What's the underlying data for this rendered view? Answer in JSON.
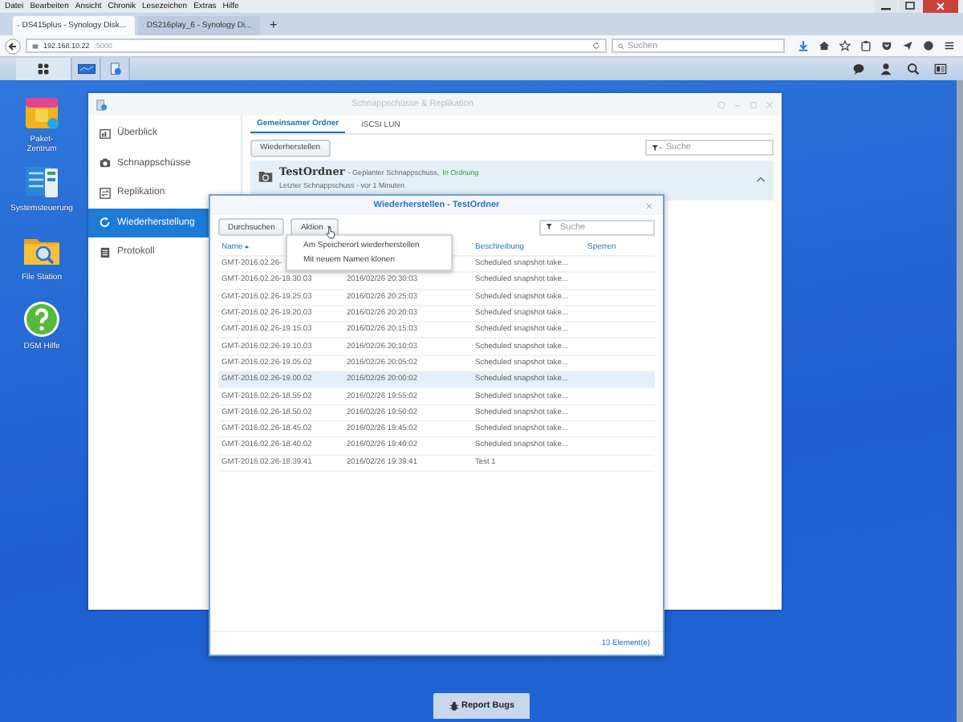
{
  "browser": {
    "menu": [
      "Datei",
      "Bearbeiten",
      "Ansicht",
      "Chronik",
      "Lesezeichen",
      "Extras",
      "Hilfe"
    ],
    "tabs": [
      {
        "label": "DS415plus - Synology Disk...",
        "selected": true
      },
      {
        "label": "DS216play_6 - Synology Di...",
        "selected": false
      }
    ],
    "new_tab": "+",
    "address": {
      "host": "192.168.10.22",
      "port": ":5000"
    },
    "search": {
      "placeholder": "Suchen"
    }
  },
  "desktop_icons": [
    {
      "label": "Paket-Zentrum",
      "kind": "package"
    },
    {
      "label": "Systemsteuerung",
      "kind": "settings"
    },
    {
      "label": "File Station",
      "kind": "folder"
    },
    {
      "label": "DSM Hilfe",
      "kind": "help"
    }
  ],
  "window": {
    "title": "Schnappschüsse & Replikation",
    "sidebar": [
      {
        "label": "Überblick",
        "kind": "overview",
        "selected": false
      },
      {
        "label": "Schnappschüsse",
        "kind": "camera",
        "selected": false
      },
      {
        "label": "Replikation",
        "kind": "replication",
        "selected": false
      },
      {
        "label": "Wiederherstellung",
        "kind": "restore",
        "selected": true
      },
      {
        "label": "Protokoll",
        "kind": "log",
        "selected": false
      }
    ],
    "tabs": [
      {
        "label": "Gemeinsamer Ordner",
        "selected": true
      },
      {
        "label": "iSCSI LUN",
        "selected": false
      }
    ],
    "restore_button": "Wiederherstellen",
    "search": {
      "placeholder": "Suche"
    },
    "share": {
      "name": "TestOrdner",
      "summary": "- Geplanter Schnappschuss,",
      "status": "In Ordnung",
      "detail": "Letzter Schnappschuss - vor 1 Minuten",
      "expanded": true
    }
  },
  "dialog": {
    "title": "Wiederherstellen - TestOrdner",
    "browse_button": "Durchsuchen",
    "action_button": "Aktion",
    "search": {
      "placeholder": "Suche"
    },
    "menu": [
      "Am Speicherort wiederherstellen",
      "Mit neuem Namen klonen"
    ],
    "columns": [
      {
        "label": "Name",
        "sorted": true
      },
      {
        "label": "Beschreibung",
        "sorted": false
      },
      {
        "label": "Sperren",
        "sorted": false
      }
    ],
    "rows": [
      {
        "name": "GMT-2016.02.26-",
        "description": "Scheduled snapshot take...",
        "selected": false
      },
      {
        "name": "GMT-2016.02.26-19.30.03",
        "time": "2016/02/26 20:30:03",
        "description": "Scheduled snapshot take...",
        "selected": false
      },
      {
        "name": "GMT-2016.02.26-19.25.03",
        "time": "2016/02/26 20:25:03",
        "description": "Scheduled snapshot take...",
        "selected": false
      },
      {
        "name": "GMT-2016.02.26-19.20.03",
        "time": "2016/02/26 20:20:03",
        "description": "Scheduled snapshot take...",
        "selected": false
      },
      {
        "name": "GMT-2016.02.26-19.15.03",
        "time": "2016/02/26 20:15:03",
        "description": "Scheduled snapshot take...",
        "selected": false
      },
      {
        "name": "GMT-2016.02.26-19.10.03",
        "time": "2016/02/26 20:10:03",
        "description": "Scheduled snapshot take...",
        "selected": false
      },
      {
        "name": "GMT-2016.02.26-19.05.02",
        "time": "2016/02/26 20:05:02",
        "description": "Scheduled snapshot take...",
        "selected": false
      },
      {
        "name": "GMT-2016.02.26-19.00.02",
        "time": "2016/02/26 20:00:02",
        "description": "Scheduled snapshot take...",
        "selected": true
      },
      {
        "name": "GMT-2016.02.26-18.55.02",
        "time": "2016/02/26 19:55:02",
        "description": "Scheduled snapshot take...",
        "selected": false
      },
      {
        "name": "GMT-2016.02.26-18.50.02",
        "time": "2016/02/26 19:50:02",
        "description": "Scheduled snapshot take...",
        "selected": false
      },
      {
        "name": "GMT-2016.02.26-18.45.02",
        "time": "2016/02/26 19:45:02",
        "description": "Scheduled snapshot take...",
        "selected": false
      },
      {
        "name": "GMT-2016.02.26-18.40.02",
        "time": "2016/02/26 19:40:02",
        "description": "Scheduled snapshot take...",
        "selected": false
      },
      {
        "name": "GMT-2016.02.26-18.39.41",
        "time": "2016/02/26 19:39:41",
        "description": "Test 1",
        "selected": false
      }
    ],
    "footer": "13 Element(e)"
  },
  "report_button": "Report Bugs"
}
